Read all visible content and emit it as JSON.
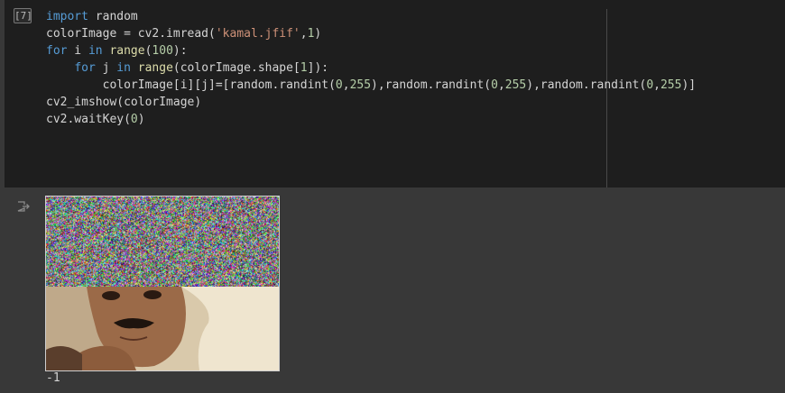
{
  "cell": {
    "execution_count": "[7]",
    "code_lines": [
      "import random",
      "colorImage = cv2.imread('kamal.jfif',1)",
      "for i in range(100):",
      "    for j in range(colorImage.shape[1]):",
      "        colorImage[i][j]=[random.randint(0,255),random.randint(0,255),random.randint(0,255)]",
      "cv2_imshow(colorImage)",
      "cv2.waitKey(0)"
    ]
  },
  "output": {
    "icon": "output-redirect-icon",
    "image_alt": "noise-over-portrait-image",
    "text": "-1"
  },
  "colors": {
    "code_bg": "#1e1e1e",
    "cell_bg": "#383838",
    "keyword": "#569cd6",
    "function": "#dcdcaa",
    "string": "#ce9178",
    "number": "#b5cea8"
  }
}
